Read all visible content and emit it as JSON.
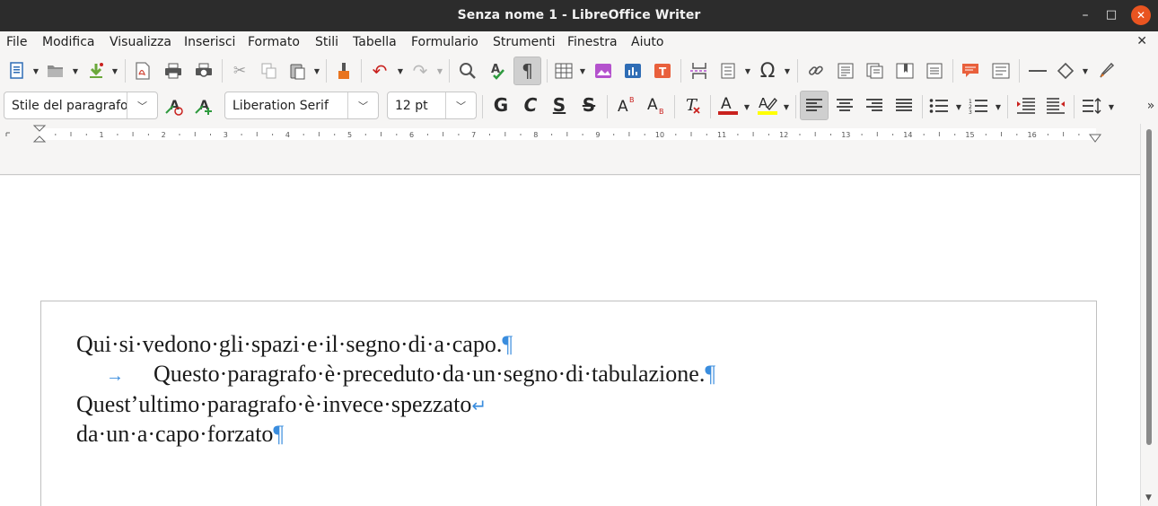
{
  "window": {
    "title": "Senza nome 1 - LibreOffice Writer",
    "minimize": "–",
    "maximize": "□",
    "close": "✕"
  },
  "menu": {
    "items": [
      "File",
      "Modifica",
      "Visualizza",
      "Inserisci",
      "Formato",
      "Stili",
      "Tabella",
      "Formulario",
      "Strumenti",
      "Finestra",
      "Aiuto"
    ],
    "doc_close": "✕"
  },
  "formatting": {
    "paragraph_style": "Stile del paragrafo",
    "font_name": "Liberation Serif",
    "font_size": "12 pt"
  },
  "ruler": {
    "numbers": [
      "1",
      "2",
      "3",
      "4",
      "5",
      "6",
      "7",
      "8",
      "9",
      "10",
      "11",
      "12",
      "13",
      "14",
      "15",
      "16"
    ]
  },
  "document": {
    "lines": [
      {
        "text": "Qui·si·vedono·gli·spazi·e·il·segno·di·a·capo.",
        "mark": "¶"
      },
      {
        "text": "Questo·paragrafo·è·preceduto·da·un·segno·di·tabulazione.",
        "mark": "¶",
        "tab": "→"
      },
      {
        "text": "Quest’ultimo·paragrafo·è·invece·spezzato",
        "mark": "↵"
      },
      {
        "text": "da·un·a·capo·forzato",
        "mark": "¶"
      }
    ]
  },
  "colors": {
    "accent_close": "#e95420",
    "formatting_marks": "#3a8dde",
    "font_color_bar": "#c9211e",
    "highlight_bar": "#ffff00"
  }
}
